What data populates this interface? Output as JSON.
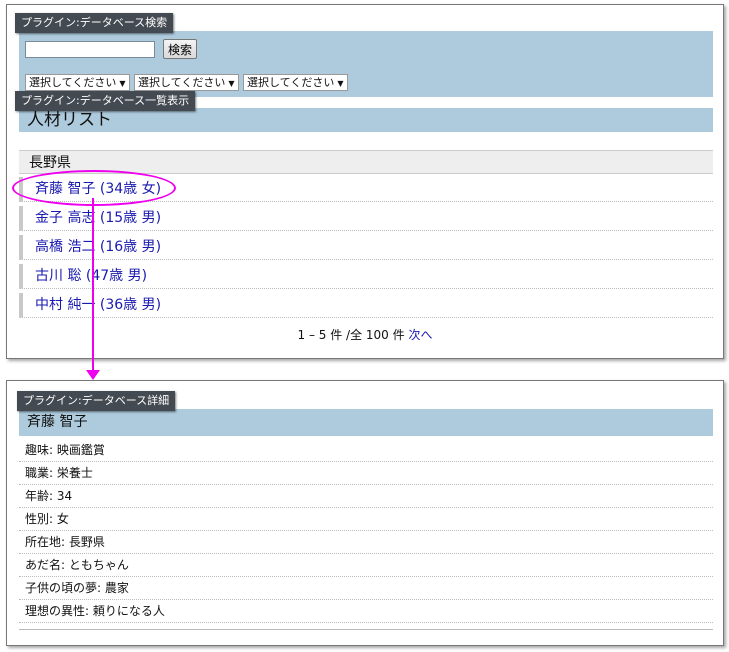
{
  "search_panel": {
    "tag": "プラグイン:データベース検索",
    "button": "検索",
    "input_value": "",
    "selects": [
      "選択してください",
      "選択してください",
      "選択してください"
    ]
  },
  "list_panel": {
    "tag": "プラグイン:データベース一覧表示",
    "title": "人材リスト",
    "group": "長野県",
    "items": [
      "斉藤 智子 (34歳 女)",
      "金子 高志 (15歳 男)",
      "高橋 浩二 (16歳 男)",
      "古川 聡 (47歳 男)",
      "中村 純一 (36歳 男)"
    ],
    "pager": {
      "range": "1 – 5 件 /全 100 件",
      "next": "次へ"
    }
  },
  "detail_panel": {
    "tag": "プラグイン:データベース詳細",
    "title": "斉藤 智子",
    "rows": [
      "趣味: 映画鑑賞",
      "職業: 栄養士",
      "年齢: 34",
      "性別: 女",
      "所在地: 長野県",
      "あだ名: ともちゃん",
      "子供の頃の夢: 農家",
      "理想の異性: 頼りになる人"
    ]
  },
  "colors": {
    "header_bg": "#aecbdd",
    "highlight": "#ee00ee",
    "link": "#1a1ab0",
    "tag_bg": "#444a52"
  }
}
